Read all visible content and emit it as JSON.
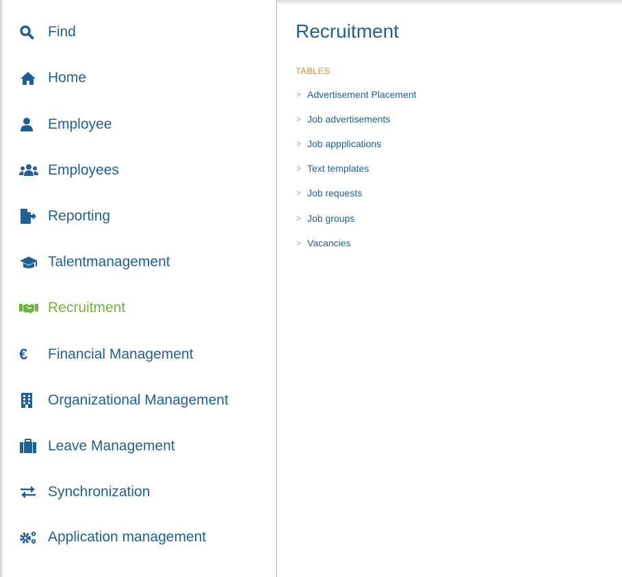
{
  "colors": {
    "primary": "#1f5f97",
    "active": "#6fb43f",
    "section": "#f08b16",
    "divider": "#d2d4d6"
  },
  "sidebar": {
    "items": [
      {
        "label": "Find",
        "icon": "search-icon"
      },
      {
        "label": "Home",
        "icon": "home-icon"
      },
      {
        "label": "Employee",
        "icon": "user-icon"
      },
      {
        "label": "Employees",
        "icon": "users-icon"
      },
      {
        "label": "Reporting",
        "icon": "file-export-icon"
      },
      {
        "label": "Talentmanagement",
        "icon": "graduation-cap-icon"
      },
      {
        "label": "Recruitment",
        "icon": "handshake-icon",
        "active": true
      },
      {
        "label": "Financial Management",
        "icon": "euro-icon"
      },
      {
        "label": "Organizational Management",
        "icon": "building-icon"
      },
      {
        "label": "Leave Management",
        "icon": "suitcase-icon"
      },
      {
        "label": "Synchronization",
        "icon": "exchange-arrows-icon"
      },
      {
        "label": "Application management",
        "icon": "cogs-icon"
      }
    ]
  },
  "main": {
    "title": "Recruitment",
    "section_title": "TABLES",
    "tables": [
      "Advertisement Placement",
      "Job advertisements",
      "Job appplications",
      "Text templates",
      "Job requests",
      "Job groups",
      "Vacancies"
    ]
  }
}
